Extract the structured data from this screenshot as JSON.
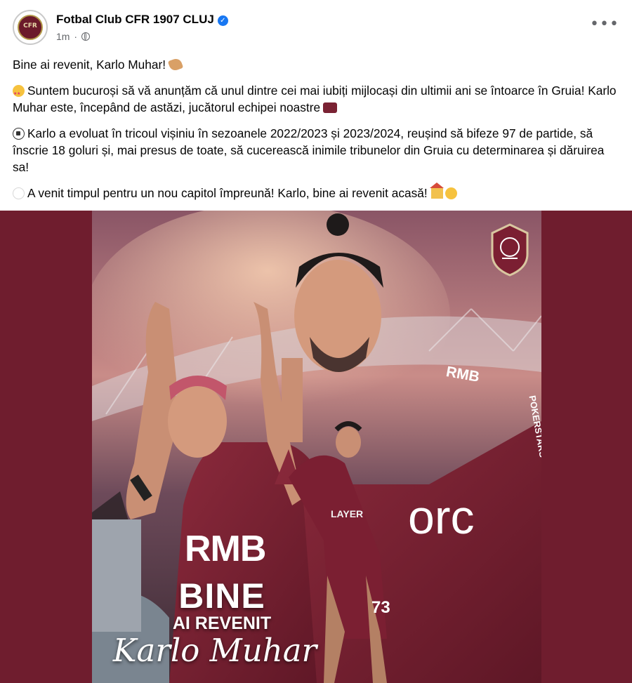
{
  "header": {
    "page_name": "Fotbal Club CFR 1907 CLUJ",
    "timestamp": "1m",
    "separator": "·",
    "more_label": "•••",
    "avatar_text": "CFR"
  },
  "post": {
    "line1": "Bine ai revenit, Karlo Muhar!",
    "line2": "Suntem bucuroși să vă anunțăm că unul dintre cei mai iubiți mijlocași din ultimii ani se întoarce în Gruia! Karlo Muhar este, începând de astăzi, jucătorul echipei noastre",
    "line3": "Karlo a evoluat în tricoul vișiniu în sezoanele 2022/2023 și 2023/2024, reușind să bifeze 97 de partide, să înscrie 18 goluri și, mai presus de toate, să cucerească inimile tribunelor din Gruia cu determinarea și dăruirea sa!",
    "line4": "A venit timpul pentru un nou capitol împreună! Karlo, bine ai revenit acasă!"
  },
  "image": {
    "title_line1": "BINE",
    "title_line2": "AI REVENIT",
    "title_line3": "Karlo Muhar",
    "sponsor_main": "RMB",
    "sponsor_small": "RMB",
    "sponsor_player": "LAYER",
    "sponsor_right": "orc",
    "sponsor_side": "POKERSTARS",
    "jersey_number": "73"
  },
  "colors": {
    "brand_maroon": "#6f1d2e",
    "verified_blue": "#1877f2",
    "meta_gray": "#65676b"
  }
}
